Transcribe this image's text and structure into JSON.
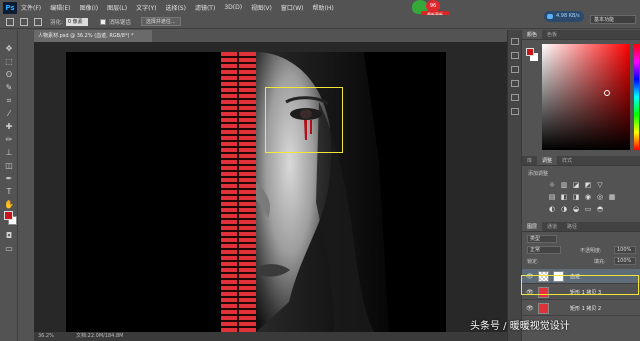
{
  "app": {
    "logo": "Ps"
  },
  "menu": [
    "文件(F)",
    "编辑(E)",
    "图像(I)",
    "图层(L)",
    "文字(Y)",
    "选择(S)",
    "滤镜(T)",
    "3D(D)",
    "视图(V)",
    "窗口(W)",
    "帮助(H)"
  ],
  "badge": {
    "count": "96",
    "tag": "最新更新"
  },
  "speed": {
    "text": "4.98 KB/s"
  },
  "options": {
    "feather_label": "羽化:",
    "feather_value": "0 像素",
    "antialias_label": "消除锯齿",
    "refine_button": "选择并遮住..."
  },
  "workspace": "基本功能",
  "document": {
    "tab_title": "人物素材.psd @ 36.2% (血迹, RGB/8*) *",
    "status_zoom": "36.2%",
    "status_doc": "文档:22.0M/184.8M"
  },
  "colors": {
    "foreground": "#c8171c",
    "background": "#ffffff",
    "accent": "#f2e63a"
  },
  "panels": {
    "color_tabs": [
      "颜色",
      "色板"
    ],
    "adjust_tabs": [
      "库",
      "调整",
      "样式"
    ],
    "adjust_label": "添加调整",
    "layers_tabs": [
      "图层",
      "通道",
      "路径"
    ],
    "kind_label": "类型",
    "blend_mode": "正常",
    "opacity_label": "不透明度:",
    "opacity_value": "100%",
    "lock_label": "锁定:",
    "fill_label": "填充:",
    "fill_value": "100%",
    "layers": [
      {
        "name": "血迹",
        "active": true
      },
      {
        "name": "矩形 1 拷贝 3",
        "active": false
      },
      {
        "name": "矩形 1 拷贝 2",
        "active": false
      }
    ]
  },
  "watermark": "头条号 / 暖暖视觉设计"
}
